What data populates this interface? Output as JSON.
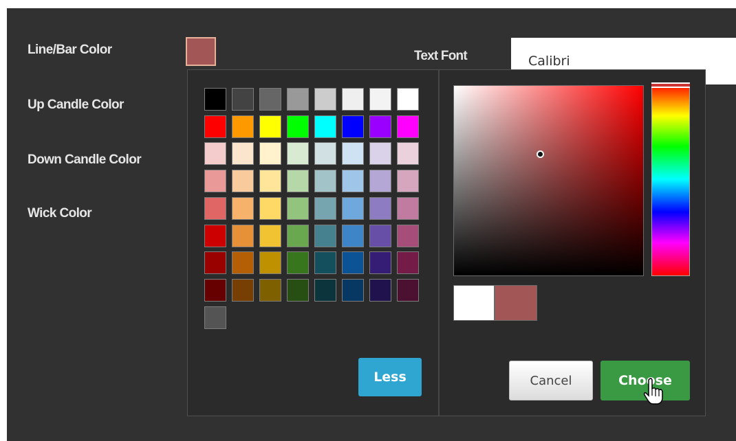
{
  "properties": {
    "line_bar_color": "Line/Bar Color",
    "up_candle_color": "Up Candle Color",
    "down_candle_color": "Down Candle Color",
    "wick_color": "Wick Color",
    "current_color": "#a35656",
    "text_font_label": "Text Font",
    "text_font_value": "Calibri"
  },
  "picker": {
    "palette": [
      [
        "#000000",
        "#434343",
        "#666666",
        "#999999",
        "#cccccc",
        "#efefef",
        "#f3f3f3",
        "#ffffff"
      ],
      [
        "#ff0000",
        "#ff9900",
        "#ffff00",
        "#00ff00",
        "#00ffff",
        "#0000ff",
        "#9900ff",
        "#ff00ff"
      ],
      [
        "#f4cccc",
        "#fce5cd",
        "#fff2cc",
        "#d9ead3",
        "#d0e0e3",
        "#cfe2f3",
        "#d9d2e9",
        "#ead1dc"
      ],
      [
        "#ea9999",
        "#f9cb9c",
        "#ffe599",
        "#b6d7a8",
        "#a2c4c9",
        "#9fc5e8",
        "#b4a7d6",
        "#d5a6bd"
      ],
      [
        "#e06666",
        "#f6b26b",
        "#ffd966",
        "#93c47d",
        "#76a5af",
        "#6fa8dc",
        "#8e7cc3",
        "#c27ba0"
      ],
      [
        "#cc0000",
        "#e69138",
        "#f1c232",
        "#6aa84f",
        "#45818e",
        "#3d85c6",
        "#674ea7",
        "#a64d79"
      ],
      [
        "#990000",
        "#b45f06",
        "#bf9000",
        "#38761d",
        "#134f5c",
        "#0b5394",
        "#351c75",
        "#741b47"
      ],
      [
        "#660000",
        "#783f04",
        "#7f6000",
        "#274e13",
        "#0c343d",
        "#073763",
        "#20124d",
        "#4c1130"
      ],
      [
        "#545454"
      ]
    ],
    "less_label": "Less",
    "new_color": "#ffffff",
    "old_color": "#a35656",
    "cancel_label": "Cancel",
    "choose_label": "Choose",
    "hue_color": "#ff0000"
  }
}
